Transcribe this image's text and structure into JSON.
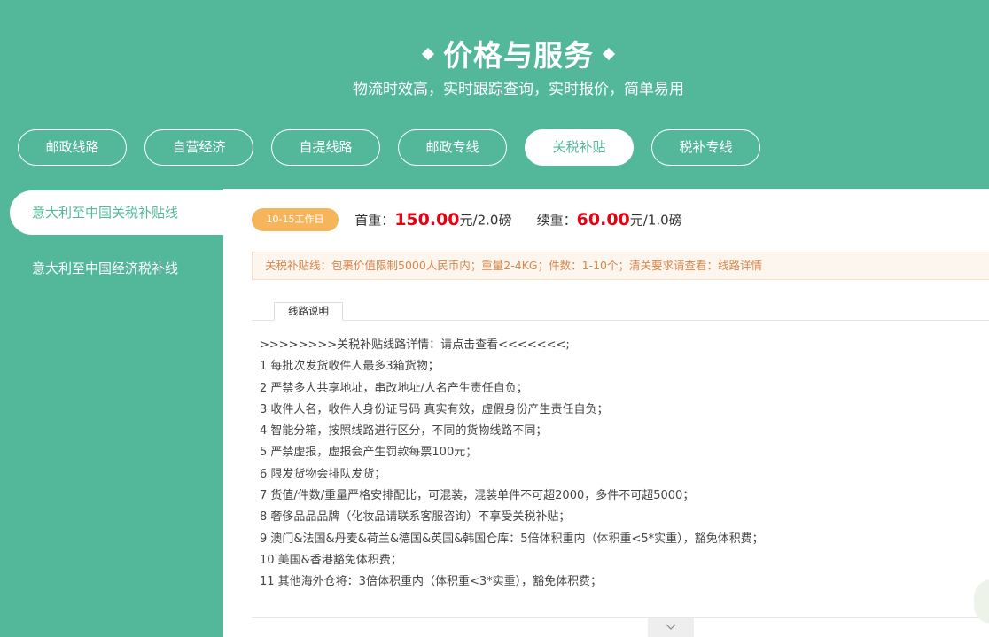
{
  "header": {
    "title": "价格与服务",
    "subtitle": "物流时效高，实时跟踪查询，实时报价，简单易用"
  },
  "tabs": [
    {
      "label": "邮政线路",
      "active": false
    },
    {
      "label": "自营经济",
      "active": false
    },
    {
      "label": "自提线路",
      "active": false
    },
    {
      "label": "邮政专线",
      "active": false
    },
    {
      "label": "关税补贴",
      "active": true
    },
    {
      "label": "税补专线",
      "active": false
    }
  ],
  "sidebar": {
    "items": [
      {
        "label": "意大利至中国关税补贴线",
        "active": true
      },
      {
        "label": "意大利至中国经济税补线",
        "active": false
      }
    ]
  },
  "price": {
    "badge": "10-15工作日",
    "first_label": "首重：",
    "first_value": "150.00",
    "first_unit": "元/2.0磅",
    "renew_label": "续重：",
    "renew_value": "60.00",
    "renew_unit": "元/1.0磅"
  },
  "notice": "关税补贴线：包裹价值限制5000人民币内；重量2-4KG；件数：1-10个；清关要求请查看：线路详情",
  "detail_tab": "线路说明",
  "details": [
    ">>>>>>>>关税补贴线路详情：请点击查看<<<<<<<;",
    "1 每批次发货收件人最多3箱货物；",
    "2 严禁多人共享地址，串改地址/人名产生责任自负；",
    "3 收件人名，收件人身份证号码 真实有效，虚假身份产生责任自负；",
    "4 智能分箱，按照线路进行区分，不同的货物线路不同；",
    "5 严禁虚报，虚报会产生罚款每票100元；",
    "6 限发货物会排队发货；",
    "7 货值/件数/重量严格安排配比，可混装，混装单件不可超2000，多件不可超5000；",
    "8 奢侈品品品牌（化妆品请联系客服咨询）不享受关税补贴；",
    "9 澳门&法国&丹麦&荷兰&德国&英国&韩国仓库：5倍体积重内（体积重<5*实重），豁免体积费；",
    "10 美国&香港豁免体积费；",
    "11 其他海外仓将：3倍体积重内（体积重<3*实重），豁免体积费；"
  ],
  "colors": {
    "brand": "#53b899",
    "price": "#e60012",
    "badge": "#f7b55b",
    "notice_text": "#d8864a"
  },
  "icons": {
    "expand": "chevron-down-icon"
  }
}
